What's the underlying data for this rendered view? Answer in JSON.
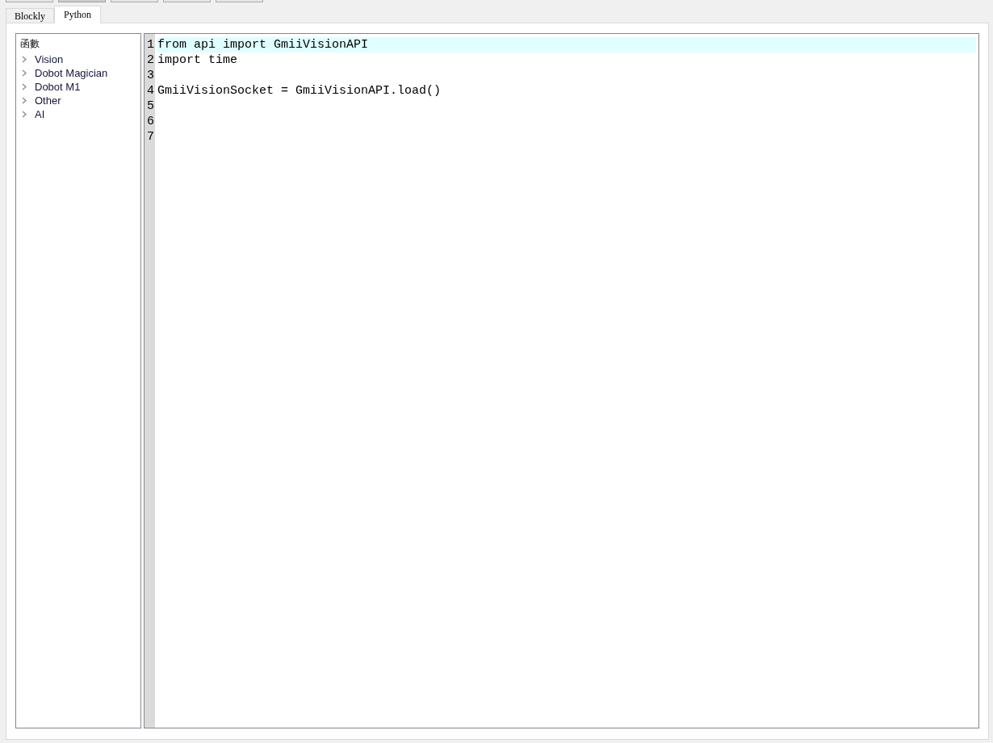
{
  "toolbar_buttons": [
    {
      "pressed": false
    },
    {
      "pressed": true
    },
    {
      "pressed": false
    },
    {
      "pressed": false
    },
    {
      "pressed": false
    }
  ],
  "tabs": [
    {
      "label": "Blockly",
      "selected": false
    },
    {
      "label": "Python",
      "selected": true
    }
  ],
  "function_panel": {
    "title": "函數",
    "items": [
      {
        "label": "Vision",
        "expanded": false
      },
      {
        "label": "Dobot Magician",
        "expanded": false
      },
      {
        "label": "Dobot M1",
        "expanded": false
      },
      {
        "label": "Other",
        "expanded": false
      },
      {
        "label": "AI",
        "expanded": false
      }
    ]
  },
  "editor": {
    "lines": [
      {
        "number": "1",
        "text": "from api import GmiiVisionAPI",
        "current": true
      },
      {
        "number": "2",
        "text": "import time",
        "current": false
      },
      {
        "number": "3",
        "current": false
      },
      {
        "number": "4",
        "text": "GmiiVisionSocket = GmiiVisionAPI.load()",
        "current": false
      },
      {
        "number": "5",
        "current": false
      },
      {
        "number": "6",
        "current": false
      },
      {
        "number": "7",
        "current": false
      }
    ]
  }
}
